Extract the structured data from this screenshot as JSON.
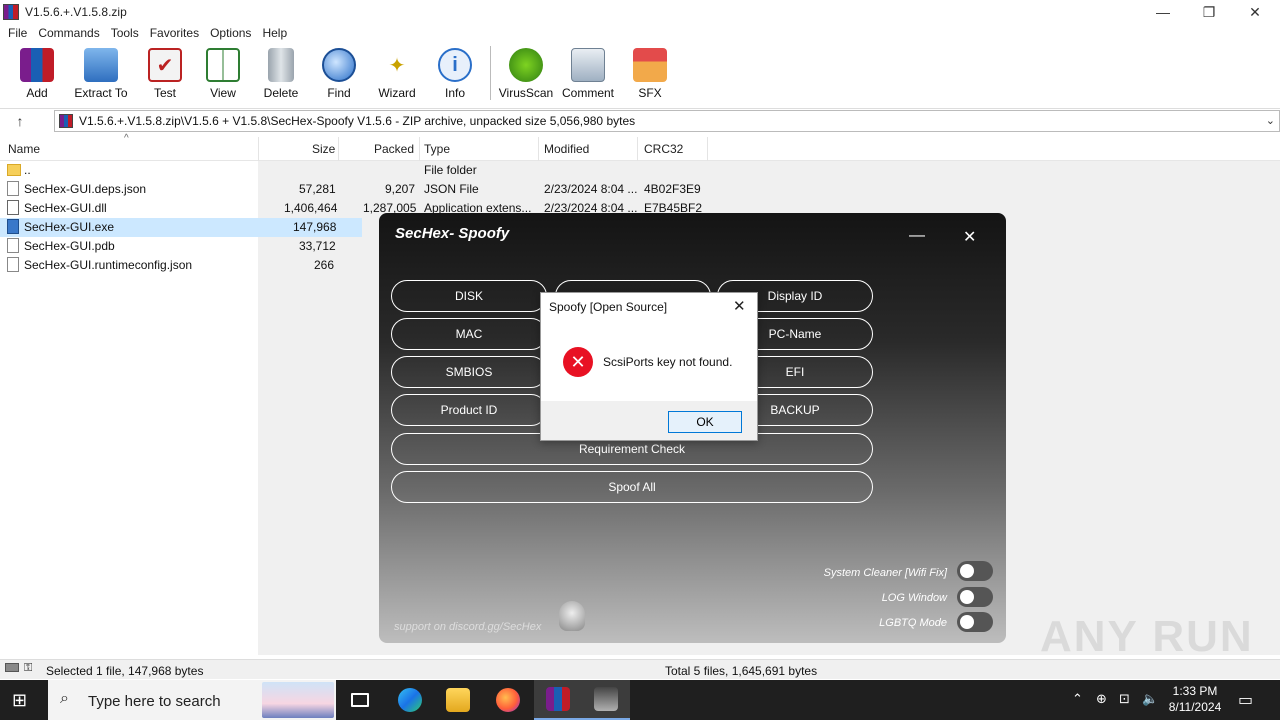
{
  "window": {
    "title": "V1.5.6.+.V1.5.8.zip",
    "minimize": "—",
    "restore": "❐",
    "close": "✕"
  },
  "menu": [
    "File",
    "Commands",
    "Tools",
    "Favorites",
    "Options",
    "Help"
  ],
  "toolbar": [
    {
      "label": "Add",
      "icon": "add-archive-icon"
    },
    {
      "label": "Extract To",
      "icon": "extract-folder-icon"
    },
    {
      "label": "Test",
      "icon": "test-clipboard-icon"
    },
    {
      "label": "View",
      "icon": "view-book-icon"
    },
    {
      "label": "Delete",
      "icon": "trash-icon"
    },
    {
      "label": "Find",
      "icon": "magnifier-icon"
    },
    {
      "label": "Wizard",
      "icon": "wand-icon"
    },
    {
      "label": "Info",
      "icon": "info-icon"
    },
    {
      "label": "VirusScan",
      "icon": "virus-icon"
    },
    {
      "label": "Comment",
      "icon": "comment-icon"
    },
    {
      "label": "SFX",
      "icon": "sfx-box-icon"
    }
  ],
  "address": {
    "path": "V1.5.6.+.V1.5.8.zip\\V1.5.6  + V1.5.8\\SecHex-Spoofy V1.5.6 - ZIP archive, unpacked size 5,056,980 bytes"
  },
  "columns": {
    "name": "Name",
    "size": "Size",
    "packed": "Packed",
    "type": "Type",
    "modified": "Modified",
    "crc": "CRC32"
  },
  "files": [
    {
      "name": "..",
      "size": "",
      "packed": "",
      "type": "File folder",
      "modified": "",
      "crc": "",
      "kind": "folder"
    },
    {
      "name": "SecHex-GUI.deps.json",
      "size": "57,281",
      "packed": "9,207",
      "type": "JSON File",
      "modified": "2/23/2024 8:04 ...",
      "crc": "4B02F3E9",
      "kind": "file"
    },
    {
      "name": "SecHex-GUI.dll",
      "size": "1,406,464",
      "packed": "1,287,005",
      "type": "Application extens...",
      "modified": "2/23/2024 8:04 ...",
      "crc": "E7B45BF2",
      "kind": "dll"
    },
    {
      "name": "SecHex-GUI.exe",
      "size": "147,968",
      "packed": "",
      "type": "",
      "modified": "",
      "crc": "",
      "kind": "exe"
    },
    {
      "name": "SecHex-GUI.pdb",
      "size": "33,712",
      "packed": "",
      "type": "",
      "modified": "",
      "crc": "",
      "kind": "file"
    },
    {
      "name": "SecHex-GUI.runtimeconfig.json",
      "size": "266",
      "packed": "",
      "type": "",
      "modified": "",
      "crc": "",
      "kind": "file"
    }
  ],
  "status": {
    "left": "Selected 1 file, 147,968 bytes",
    "right": "Total 5 files, 1,645,691 bytes"
  },
  "sechex": {
    "title": "SecHex- Spoofy",
    "minimize": "—",
    "close": "✕",
    "buttons": [
      "DISK",
      "Display ID",
      "MAC",
      "PC-Name",
      "SMBIOS",
      "EFI",
      "Product ID",
      "BACKUP",
      "Requirement Check",
      "Spoof All"
    ],
    "toggles": [
      {
        "label": "System Cleaner [Wifi Fix]",
        "on": false
      },
      {
        "label": "LOG Window",
        "on": false
      },
      {
        "label": "LGBTQ Mode",
        "on": false
      }
    ],
    "support": "support on discord.gg/SecHex"
  },
  "dialog": {
    "title": "Spoofy [Open Source]",
    "close": "✕",
    "icon": "error-icon",
    "message": "ScsiPorts key not found.",
    "ok": "OK"
  },
  "watermark": "ANY RUN",
  "taskbar": {
    "search_placeholder": "Type here to search",
    "time": "1:33 PM",
    "date": "8/11/2024"
  }
}
